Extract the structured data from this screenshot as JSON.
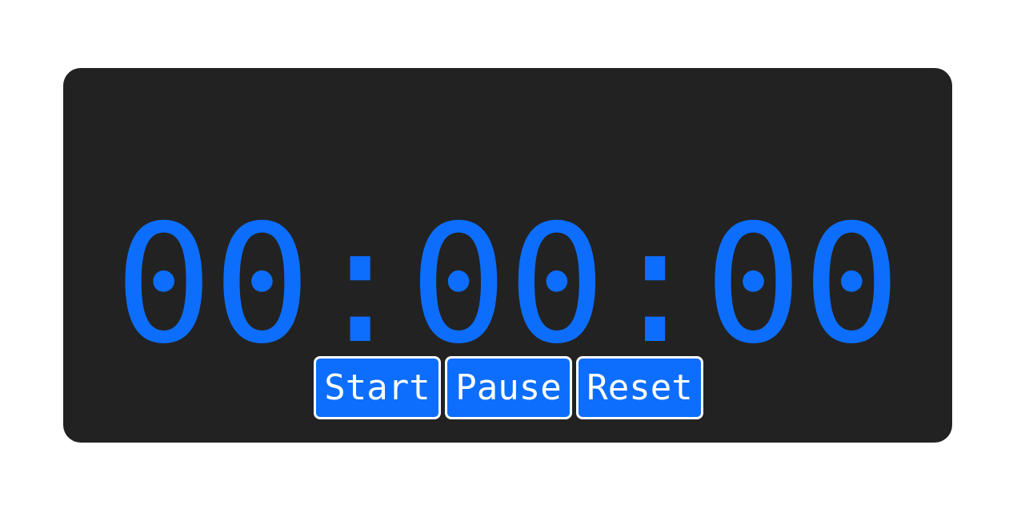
{
  "stopwatch": {
    "time": "00:00:00",
    "accent_color": "#0d6efd",
    "panel_color": "#222222"
  },
  "controls": {
    "start_label": "Start",
    "pause_label": "Pause",
    "reset_label": "Reset"
  }
}
